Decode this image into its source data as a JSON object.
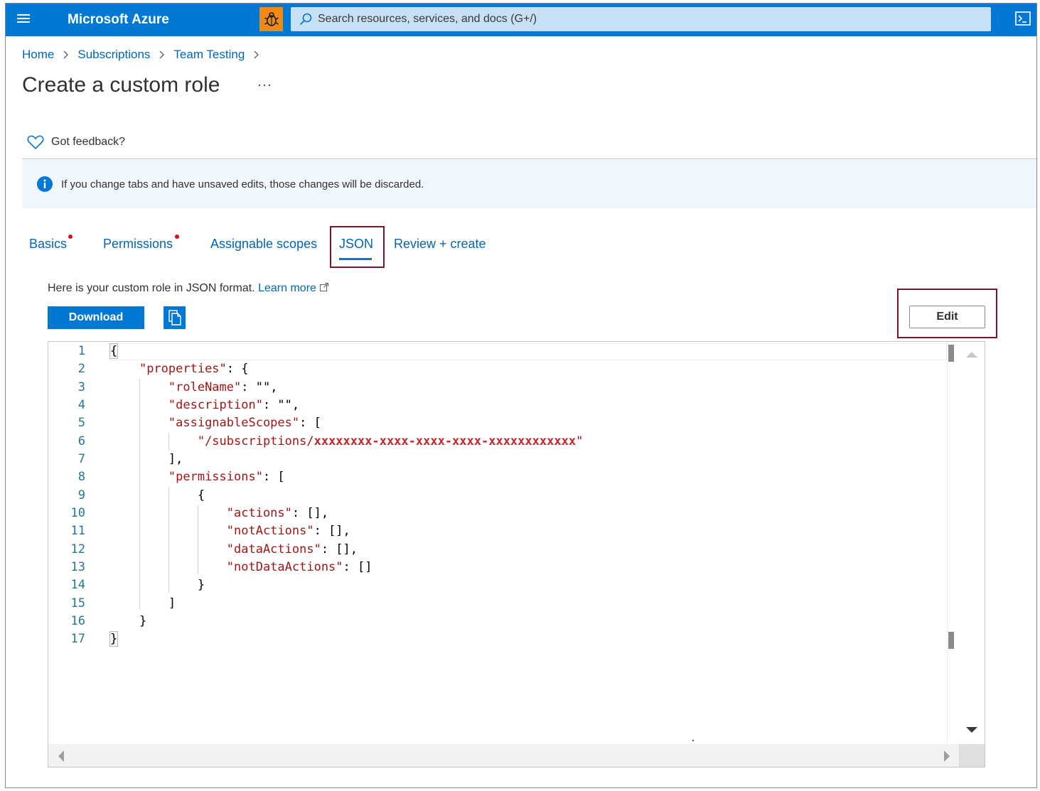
{
  "topbar": {
    "brand": "Microsoft Azure",
    "search_placeholder": "Search resources, services, and docs (G+/)"
  },
  "breadcrumb": [
    "Home",
    "Subscriptions",
    "Team Testing"
  ],
  "page": {
    "title": "Create a custom role",
    "more": "···"
  },
  "feedback": {
    "label": "Got feedback?"
  },
  "banner": {
    "text": "If you change tabs and have unsaved edits, those changes will be discarded."
  },
  "tabs": [
    {
      "label": "Basics",
      "required_dot": true
    },
    {
      "label": "Permissions",
      "required_dot": true
    },
    {
      "label": "Assignable scopes",
      "required_dot": false
    },
    {
      "label": "JSON",
      "required_dot": false,
      "selected": true
    },
    {
      "label": "Review + create",
      "required_dot": false
    }
  ],
  "json_tab": {
    "description": "Here is your custom role in JSON format.",
    "learn_more": "Learn more",
    "download_label": "Download",
    "edit_label": "Edit"
  },
  "editor": {
    "line_numbers": [
      "1",
      "2",
      "3",
      "4",
      "5",
      "6",
      "7",
      "8",
      "9",
      "10",
      "11",
      "12",
      "13",
      "14",
      "15",
      "16",
      "17"
    ],
    "keys": {
      "properties": "\"properties\"",
      "roleName": "\"roleName\"",
      "description": "\"description\"",
      "assignableScopes": "\"assignableScopes\"",
      "scope_prefix": "\"/subscriptions/",
      "scope_id": "xxxxxxxx-xxxx-xxxx-xxxx-xxxxxxxxxxxx",
      "scope_suffix": "\"",
      "permissions": "\"permissions\"",
      "actions": "\"actions\"",
      "notActions": "\"notActions\"",
      "dataActions": "\"dataActions\"",
      "notDataActions": "\"notDataActions\""
    }
  },
  "colors": {
    "azure_blue": "#0078d4",
    "highlight_border": "#7a1628",
    "json_key": "#a31515",
    "line_number": "#237893"
  }
}
